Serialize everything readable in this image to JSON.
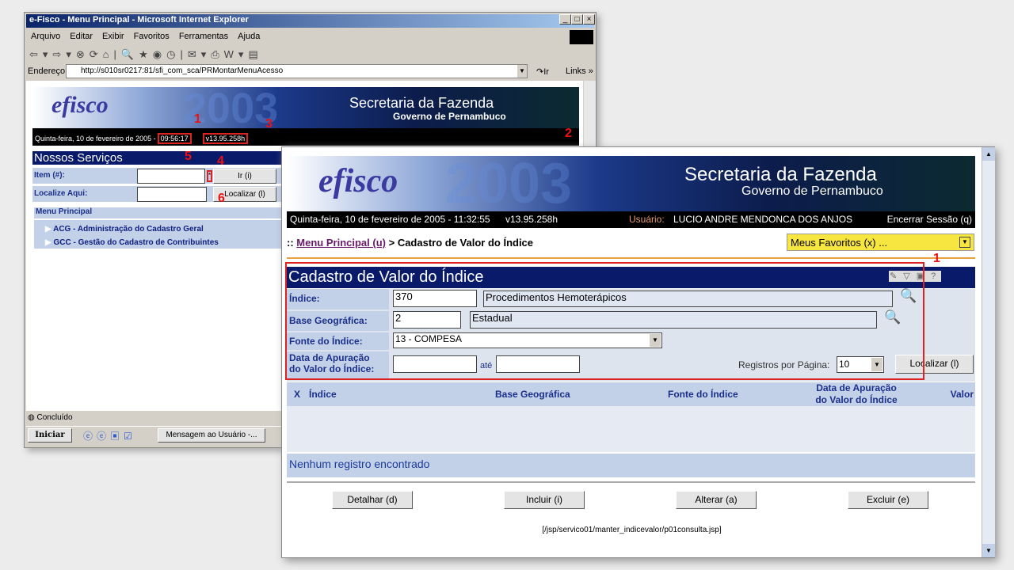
{
  "back_window": {
    "title": "e-Fisco - Menu Principal - Microsoft Internet Explorer",
    "menu": [
      "Arquivo",
      "Editar",
      "Exibir",
      "Favoritos",
      "Ferramentas",
      "Ajuda"
    ],
    "address_label": "Endereço",
    "address": "http://s010sr0217:81/sfi_com_sca/PRMontarMenuAcesso",
    "go_label": "Ir",
    "links_label": "Links »",
    "banner": {
      "title": "Secretaria da Fazenda",
      "subtitle": "Governo de Pernambuco",
      "logo_text": "efisco",
      "year": "2003"
    },
    "date": "Quinta-feira, 10 de fevereiro de 2005 -",
    "time": "09:56:17",
    "version": "v13.95.258h",
    "services_title": "Nossos Serviços",
    "item_label": "Item (#):",
    "item_value": "",
    "ir_button": "Ir (i)",
    "find_label": "Localize Aqui:",
    "find_value": "",
    "find_button": "Localizar (l)",
    "menu_title": "Menu Principal",
    "menu_items": [
      "ACG - Administração do Cadastro Geral",
      "GCC - Gestão do Cadastro de Contribuintes"
    ],
    "status": "Concluído",
    "taskbar": {
      "start": "Iniciar",
      "task": "Mensagem ao Usuário -..."
    },
    "annotations": [
      "1",
      "2",
      "3",
      "4",
      "5",
      "6"
    ]
  },
  "front_window": {
    "banner": {
      "title": "Secretaria da Fazenda",
      "subtitle": "Governo de Pernambuco",
      "logo_text": "efisco",
      "year": "2003"
    },
    "date": "Quinta-feira, 10 de fevereiro de 2005 - 11:32:55",
    "version": "v13.95.258h",
    "user_label": "Usuário:",
    "user": "LUCIO ANDRE MENDONCA DOS ANJOS",
    "logout": "Encerrar Sessão (q)",
    "breadcrumb": {
      "prefix": "::",
      "link": "Menu Principal (u)",
      "sep": ">",
      "current": "Cadastro de Valor do Índice"
    },
    "favorites": "Meus Favoritos (x) ...",
    "annotation": "1",
    "form": {
      "title": "Cadastro de Valor do Índice",
      "indice_label": "Índice:",
      "indice_code": "370",
      "indice_desc": "Procedimentos Hemoterápicos",
      "base_label": "Base Geográfica:",
      "base_code": "2",
      "base_desc": "Estadual",
      "fonte_label": "Fonte do Índice:",
      "fonte_value": "13 - COMPESA",
      "data_label_1": "Data de Apuração",
      "data_label_2": "do Valor do Índice:",
      "ate": "até",
      "data_from": "",
      "data_to": "",
      "per_page_label": "Registros por Página:",
      "per_page": "10",
      "search_button": "Localizar (l)"
    },
    "table": {
      "headers": [
        "X",
        "Índice",
        "Base Geográfica",
        "Fonte do Índice",
        "Data de Apuração",
        "do Valor do Índice",
        "Valor"
      ],
      "empty": "Nenhum registro encontrado"
    },
    "buttons": [
      "Detalhar (d)",
      "Incluir (i)",
      "Alterar (a)",
      "Excluir (e)"
    ],
    "path": "[/jsp/servico01/manter_indicevalor/p01consulta.jsp]"
  }
}
